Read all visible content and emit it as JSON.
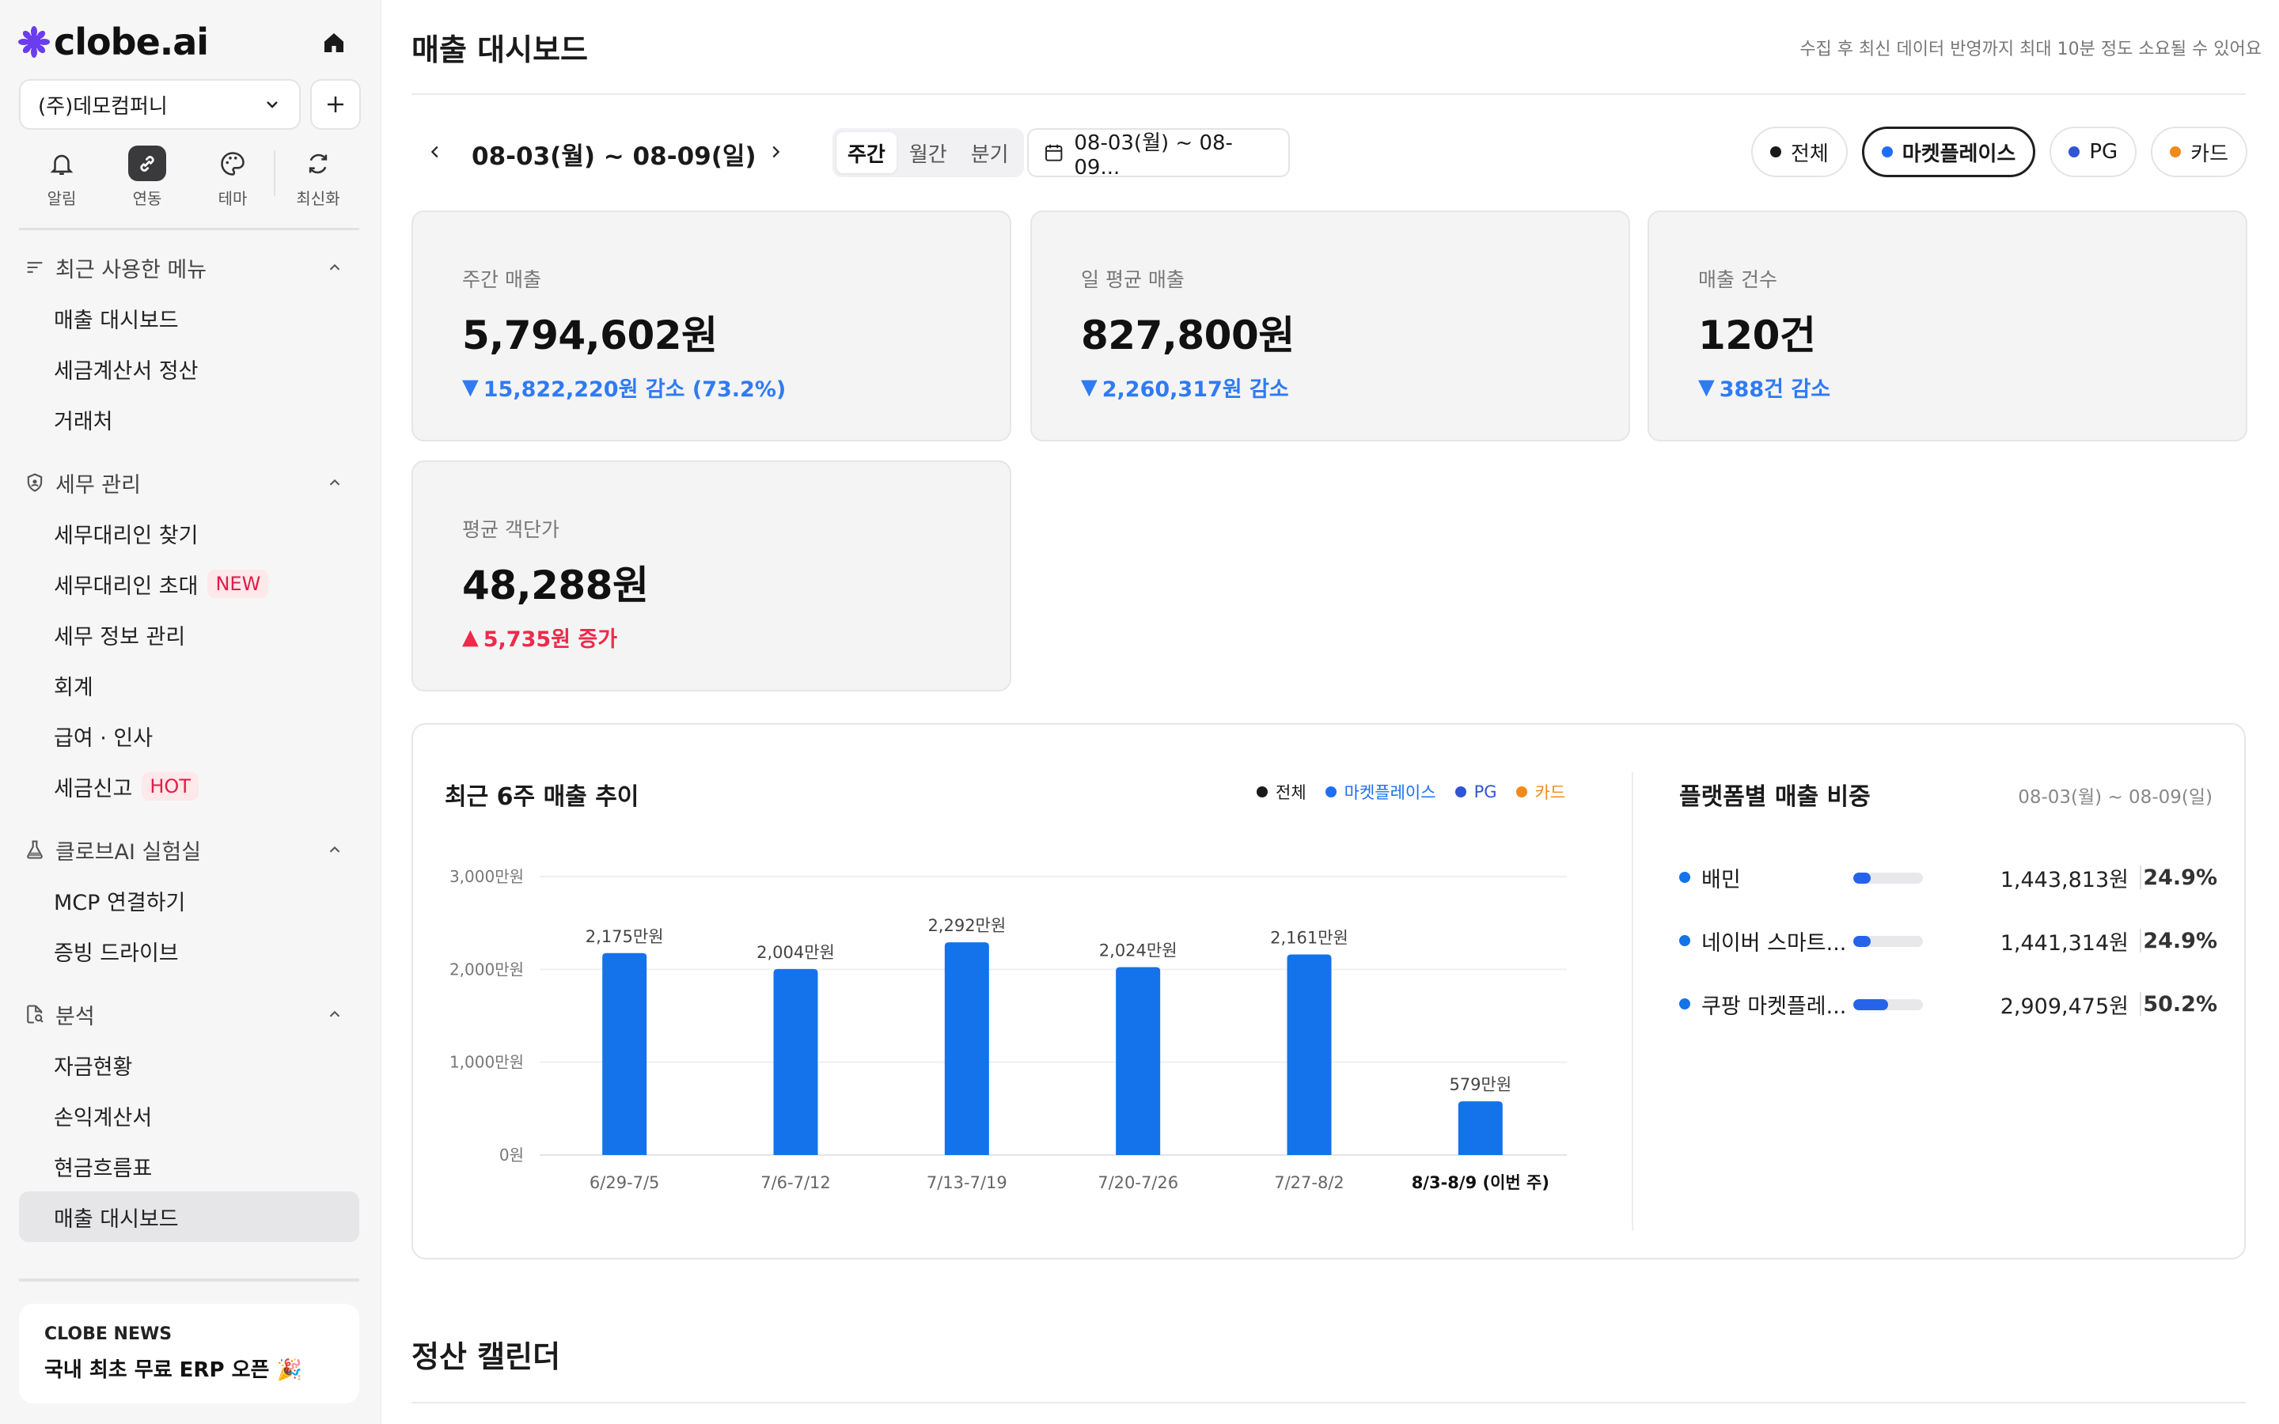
{
  "sidebar": {
    "brand": "clobe.ai",
    "company": "(주)데모컴퍼니",
    "quick": [
      {
        "label": "알림",
        "icon": "bell-icon"
      },
      {
        "label": "연동",
        "icon": "link-icon"
      },
      {
        "label": "테마",
        "icon": "palette-icon"
      },
      {
        "label": "최신화",
        "icon": "refresh-icon"
      }
    ],
    "groups": [
      {
        "title": "최근 사용한 메뉴",
        "icon": "recent-menu-icon",
        "items": [
          {
            "label": "매출 대시보드"
          },
          {
            "label": "세금계산서 정산"
          },
          {
            "label": "거래처"
          }
        ]
      },
      {
        "title": "세무 관리",
        "icon": "shield-icon",
        "items": [
          {
            "label": "세무대리인 찾기"
          },
          {
            "label": "세무대리인 초대",
            "badge": "NEW"
          },
          {
            "label": "세무 정보 관리"
          },
          {
            "label": "회계"
          },
          {
            "label": "급여 · 인사"
          },
          {
            "label": "세금신고",
            "badge": "HOT"
          }
        ]
      },
      {
        "title": "클로브AI 실험실",
        "icon": "flask-icon",
        "items": [
          {
            "label": "MCP 연결하기"
          },
          {
            "label": "증빙 드라이브"
          }
        ]
      },
      {
        "title": "분석",
        "icon": "doc-search-icon",
        "items": [
          {
            "label": "자금현황"
          },
          {
            "label": "손익계산서"
          },
          {
            "label": "현금흐름표"
          },
          {
            "label": "매출 대시보드"
          }
        ]
      }
    ],
    "news": {
      "tag": "CLOBE NEWS",
      "title": "국내 최초 무료 ERP 오픈 🎉"
    }
  },
  "header": {
    "title": "매출 대시보드",
    "notice": "수집 후 최신 데이터 반영까지 최대 10분 정도 소요될 수 있어요"
  },
  "toolbar": {
    "range": "08-03(월) ~ 08-09(일)",
    "periods": [
      "주간",
      "월간",
      "분기"
    ],
    "date_picker": "08-03(월) ~ 08-09...",
    "filters": [
      {
        "label": "전체",
        "color": "#1a1a1a"
      },
      {
        "label": "마켓플레이스",
        "color": "#1d6ff2"
      },
      {
        "label": "PG",
        "color": "#2f55d4"
      },
      {
        "label": "카드",
        "color": "#f08a1c"
      }
    ]
  },
  "kpis": [
    {
      "label": "주간 매출",
      "value": "5,794,602원",
      "delta": "15,822,220원 감소 (73.2%)",
      "dir": "down"
    },
    {
      "label": "일 평균 매출",
      "value": "827,800원",
      "delta": "2,260,317원 감소",
      "dir": "down"
    },
    {
      "label": "매출 건수",
      "value": "120건",
      "delta": "388건 감소",
      "dir": "down"
    },
    {
      "label": "평균 객단가",
      "value": "48,288원",
      "delta": "5,735원 증가",
      "dir": "up"
    }
  ],
  "colors": {
    "bar": "#1472ea",
    "down": "#2f7bf2",
    "up": "#ee2a4a"
  },
  "chart_data": {
    "type": "bar",
    "title": "최근 6주 매출 추이",
    "categories": [
      "6/29-7/5",
      "7/6-7/12",
      "7/13-7/19",
      "7/20-7/26",
      "7/27-8/2",
      "8/3-8/9 (이번 주)"
    ],
    "values": [
      2175,
      2004,
      2292,
      2024,
      2161,
      579
    ],
    "value_labels": [
      "2,175만원",
      "2,004만원",
      "2,292만원",
      "2,024만원",
      "2,161만원",
      "579만원"
    ],
    "yticks": [
      0,
      1000,
      2000,
      3000
    ],
    "ytick_labels": [
      "0원",
      "1,000만원",
      "2,000만원",
      "3,000만원"
    ],
    "ylim": [
      0,
      3000
    ],
    "grid": true,
    "legend": [
      "전체",
      "마켓플레이스",
      "PG",
      "카드"
    ],
    "legend_placement": "top-right"
  },
  "platforms": {
    "title": "플랫폼별 매출 비중",
    "range": "08-03(월) ~ 08-09(일)",
    "rows": [
      {
        "name": "배민",
        "amount": "1,443,813원",
        "pct": "24.9%",
        "share": 0.249
      },
      {
        "name": "네이버 스마트...",
        "amount": "1,441,314원",
        "pct": "24.9%",
        "share": 0.249
      },
      {
        "name": "쿠팡 마켓플레...",
        "amount": "2,909,475원",
        "pct": "50.2%",
        "share": 0.502
      }
    ]
  },
  "calendar": {
    "title": "정산 캘린더"
  }
}
